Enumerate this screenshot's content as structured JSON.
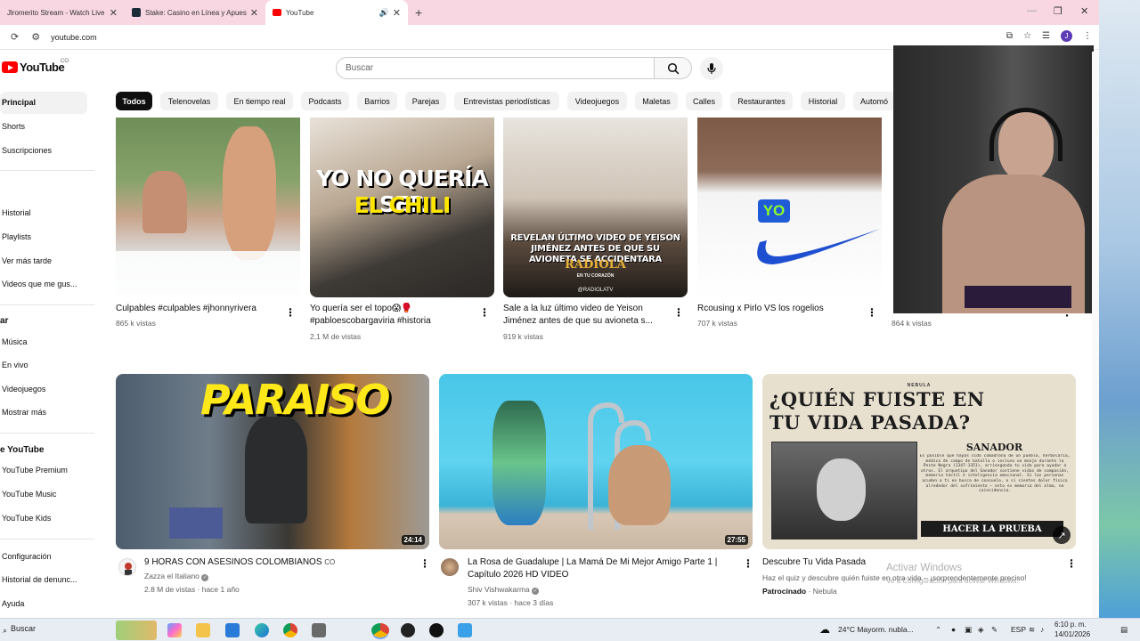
{
  "browser": {
    "tabs": [
      {
        "label": "Jlromerito Stream - Watch Live",
        "active": false
      },
      {
        "label": "Stake: Casino en Línea y Apuestas",
        "active": false
      },
      {
        "label": "YouTube",
        "active": true
      }
    ],
    "url": "youtube.com"
  },
  "youtube": {
    "logo_text": "YouTube",
    "country": "CO",
    "search_placeholder": "Buscar"
  },
  "sidebar": {
    "items_top": [
      "Principal",
      "Shorts",
      "Suscripciones"
    ],
    "items_you": [
      "Historial",
      "Playlists",
      "Ver más tarde",
      "Videos que me gus..."
    ],
    "explore_heading": "ar",
    "items_explore": [
      "Música",
      "En vivo",
      "Videojuegos",
      "Mostrar más"
    ],
    "more_heading": "e YouTube",
    "items_more": [
      "YouTube Premium",
      "YouTube Music",
      "YouTube Kids"
    ],
    "items_bottom": [
      "Configuración",
      "Historial de denunc...",
      "Ayuda"
    ]
  },
  "chips": [
    "Todos",
    "Telenovelas",
    "En tiempo real",
    "Podcasts",
    "Barrios",
    "Parejas",
    "Entrevistas periodísticas",
    "Videojuegos",
    "Maletas",
    "Calles",
    "Restaurantes",
    "Historial",
    "Automó"
  ],
  "shorts": [
    {
      "title": "Culpables #culpables #jhonnyrivera",
      "views": "865 k vistas"
    },
    {
      "title": "Yo quería ser el topo😱🥊 #pabloescobargaviria #historia",
      "views": "2,1 M de vistas",
      "overlay_line1": "YO NO QUERÍA SER",
      "overlay_line2": "EL CHILI"
    },
    {
      "title": "Sale a la luz último video de Yeison Jiménez antes de que su avioneta s...",
      "views": "919 k vistas",
      "overlay": "REVELAN ÚLTIMO VIDEO DE YEISON JIMÉNEZ ANTES DE QUE SU AVIONETA SE ACCIDENTARA",
      "brand": "RADIOLA",
      "brand_sub": "EN TU CORAZÓN",
      "handle": "@RADIOLATV"
    },
    {
      "title": "Rcousing x Pirlo VS los rogelios",
      "views": "707 k vistas",
      "overlay": "YO"
    },
    {
      "title": "",
      "views": "864 k vistas"
    }
  ],
  "videos": [
    {
      "title": "9 HORAS CON ASESINOS COLOMBIANOS",
      "title_suffix": "CO",
      "channel": "Zazza el Italiano",
      "meta": "2.8 M de vistas · hace 1 año",
      "duration": "24:14",
      "overlay": "PARAISO"
    },
    {
      "title": "La Rosa de Guadalupe | La Mamá De Mi Mejor Amigo Parte 1 | Capítulo 2026 HD VIDEO",
      "channel": "Shiv Vishwakarma",
      "meta": "307 k vistas · hace 3 días",
      "duration": "27:55"
    },
    {
      "title": "Descubre Tu Vida Pasada",
      "desc": "Haz el quiz y descubre quién fuiste en otra vida – ¡sorprendentemente preciso!",
      "sponsored": "Patrocinado",
      "channel": "Nebula",
      "ad_tag": "NEBULA",
      "ad_head": "¿QUIÉN FUISTE EN TU VIDA PASADA?",
      "ad_role": "SANADOR",
      "ad_body": "Es posible que hayas sido comadrona de un pueblo, herbolaria, médico de campo de batalla o incluso un monje durante la Peste Negra (1347-1351), arriesgando tu vida para ayudar a otros. El arquetipo del Sanador sostiene vidas de compasión, memoria táctil e inteligencia emocional. Si las personas acuden a ti en busca de consuelo, o si sientes dolor físico alrededor del sufrimiento – esto es memoria del alma, no coincidencia.",
      "ad_button": "HACER LA PRUEBA"
    }
  ],
  "windows": {
    "watermark": "Activar Windows",
    "watermark_sub": "Ve a Configuración para activar Windows.",
    "search": "Buscar",
    "weather": "24°C  Mayorm. nubla...",
    "lang": "ESP",
    "time": "6:10 p. m.",
    "date": "14/01/2026"
  }
}
